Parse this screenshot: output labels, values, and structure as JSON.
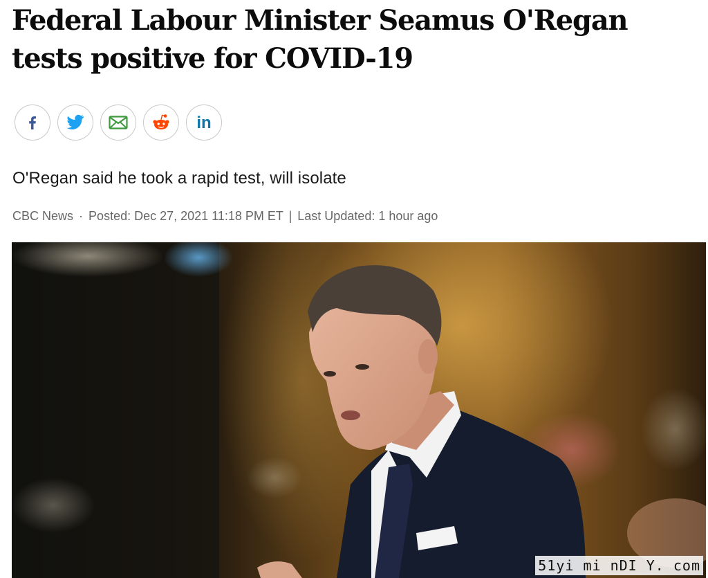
{
  "article": {
    "headline": "Federal Labour Minister Seamus O'Regan tests positive for COVID-19",
    "deck": "O'Regan said he took a rapid test, will isolate",
    "byline": {
      "source": "CBC News",
      "dot": "·",
      "posted": "Posted: Dec 27, 2021 11:18 PM ET",
      "divider": "|",
      "updated": "Last Updated: 1 hour ago"
    }
  },
  "share": {
    "buttons": [
      {
        "id": "facebook",
        "icon": "facebook-icon",
        "color": "#3b5998"
      },
      {
        "id": "twitter",
        "icon": "twitter-icon",
        "color": "#1da1f2"
      },
      {
        "id": "email",
        "icon": "email-icon",
        "color": "#3f9a3f"
      },
      {
        "id": "reddit",
        "icon": "reddit-icon",
        "color": "#ff4500"
      },
      {
        "id": "linkedin",
        "icon": "linkedin-icon",
        "color": "#0e76a8"
      }
    ]
  },
  "watermark": "51yi mi nDI Y. com"
}
